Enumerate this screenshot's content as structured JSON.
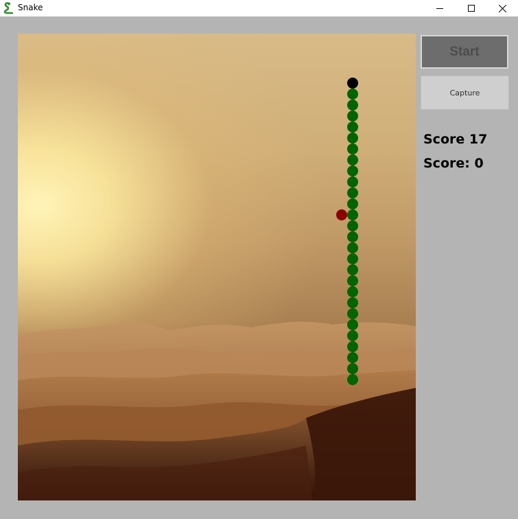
{
  "window": {
    "title": "Snake"
  },
  "controls": {
    "start_label": "Start",
    "capture_label": "Capture"
  },
  "scores": {
    "score_label": "Score 17",
    "score2_label": "Score: 0"
  },
  "colors": {
    "snake_body": "#006400",
    "snake_head": "#000000",
    "food": "#8b0000"
  }
}
